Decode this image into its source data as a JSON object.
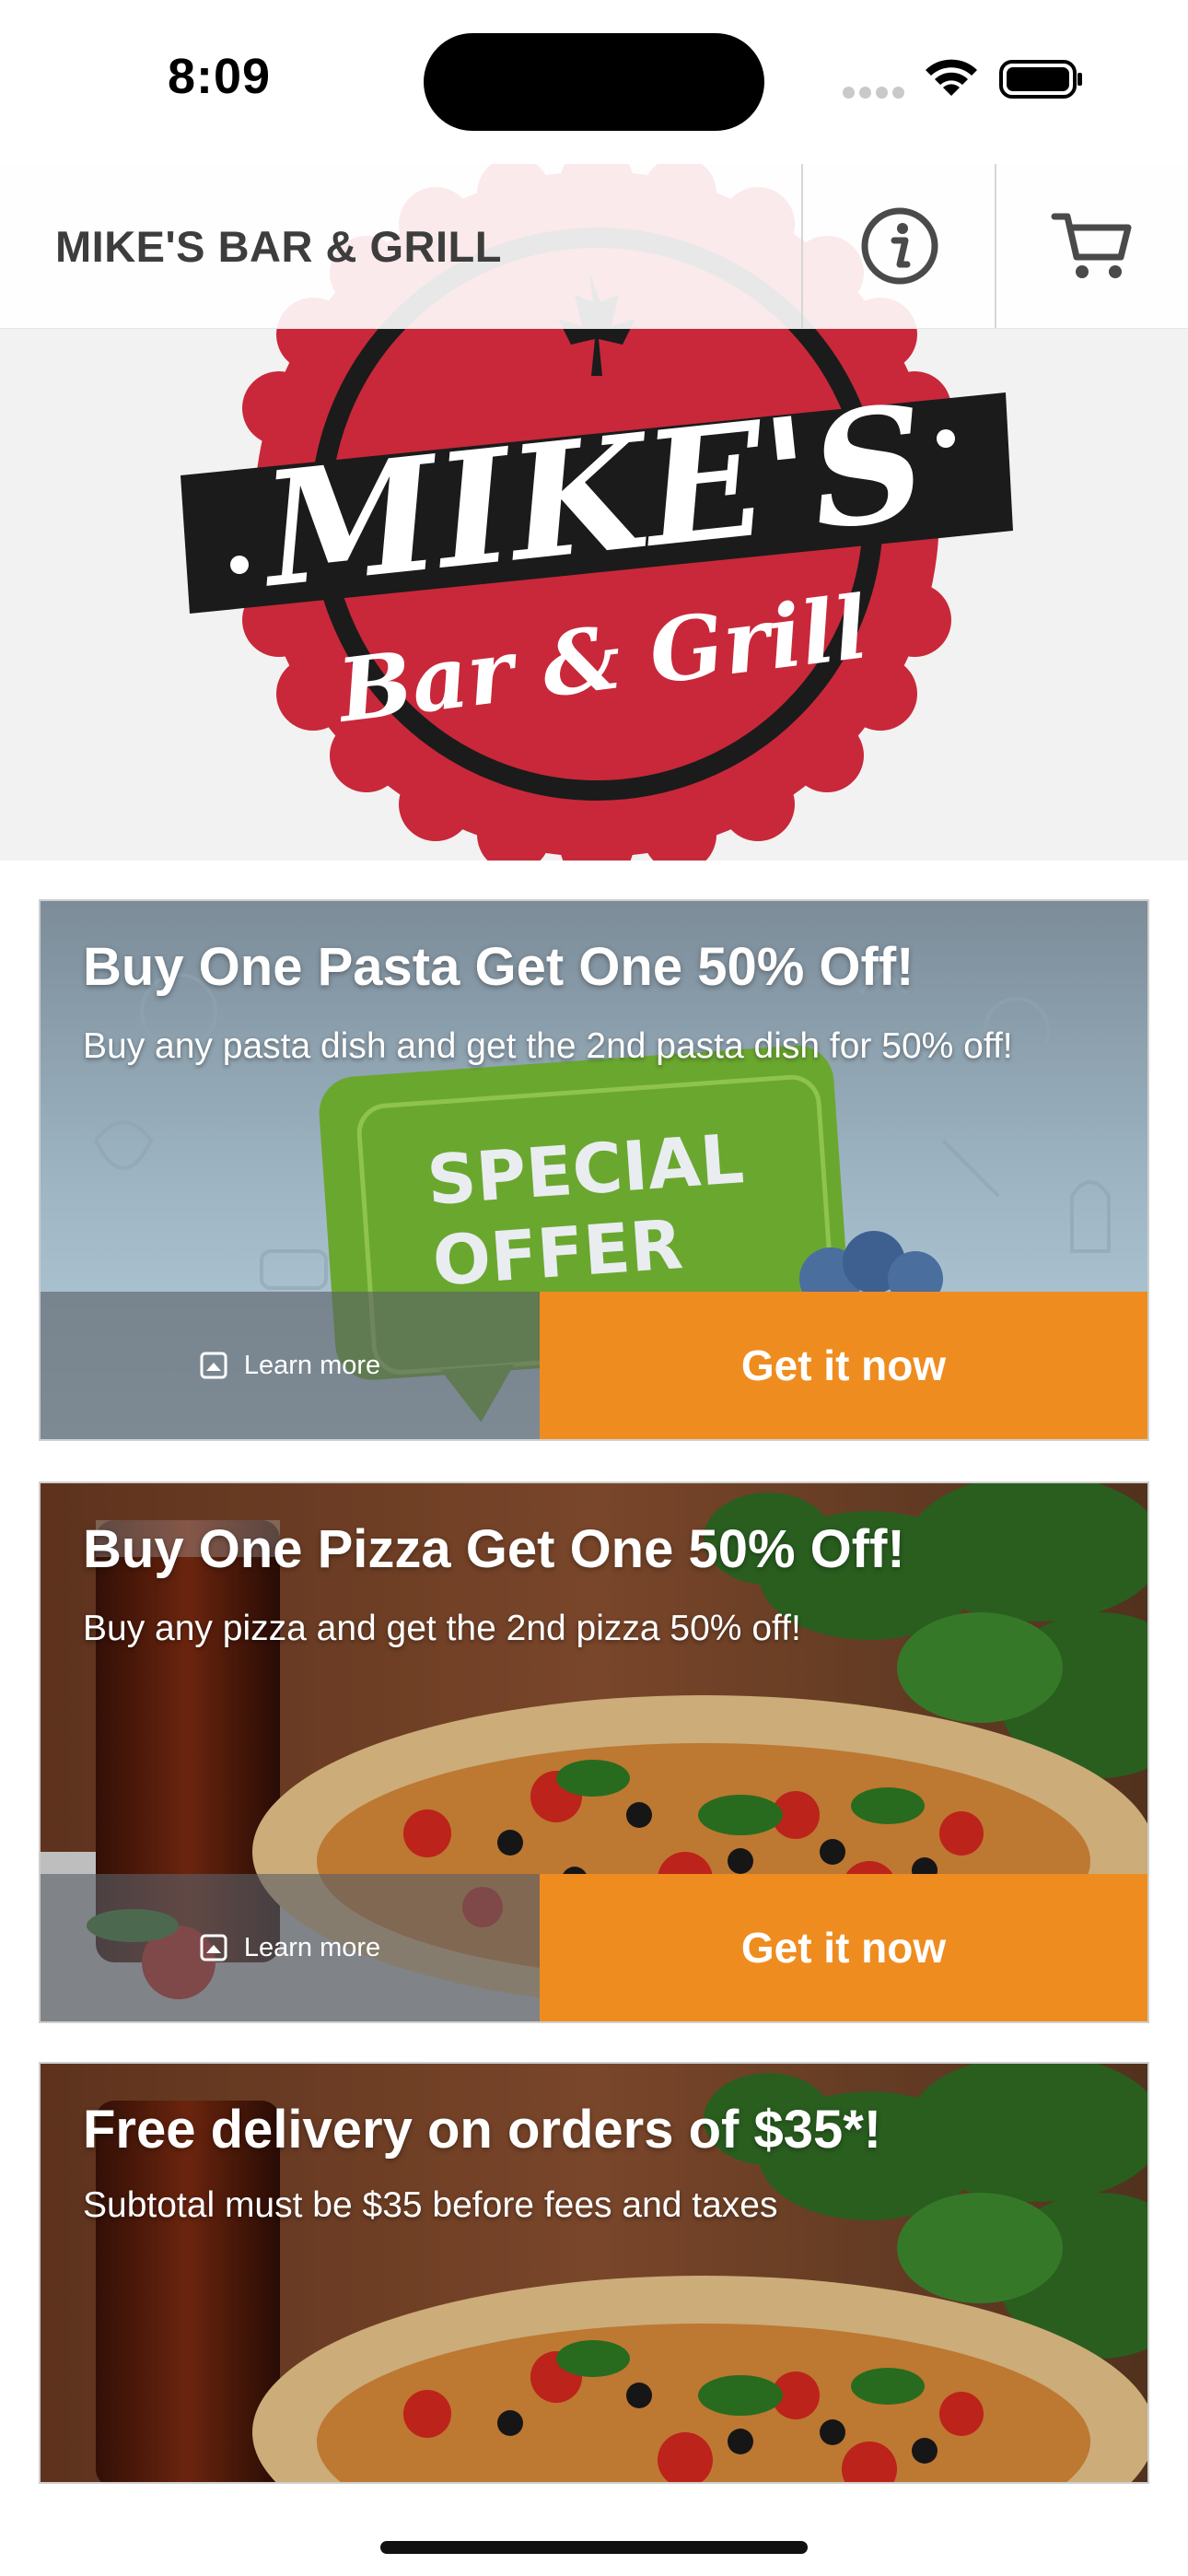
{
  "status_bar": {
    "time": "8:09"
  },
  "header": {
    "title": "MIKE'S BAR & GRILL",
    "info_icon": "info-circle-icon",
    "cart_icon": "shopping-cart-icon"
  },
  "hero": {
    "logo_line1": "MIKE'S",
    "logo_line2": "Bar & Grill",
    "logo_colors": {
      "red": "#c8283a",
      "black": "#1b1b1b",
      "white": "#ffffff"
    }
  },
  "offers": [
    {
      "title": "Buy One Pasta Get One 50% Off!",
      "description": "Buy any pasta dish and get the 2nd pasta dish for 50% off!",
      "badge_line1": "SPECIAL",
      "badge_line2": "OFFER",
      "learn_more": "Learn more",
      "cta": "Get it now"
    },
    {
      "title": "Buy One Pizza Get One 50% Off!",
      "description": "Buy any pizza and get the 2nd pizza 50% off!",
      "learn_more": "Learn more",
      "cta": "Get it now"
    },
    {
      "title": "Free delivery on orders of $35*!",
      "description": "Subtotal must be $35 before fees and taxes"
    }
  ],
  "colors": {
    "accent": "#ef8c1f",
    "header_text": "#3d3d3d"
  }
}
